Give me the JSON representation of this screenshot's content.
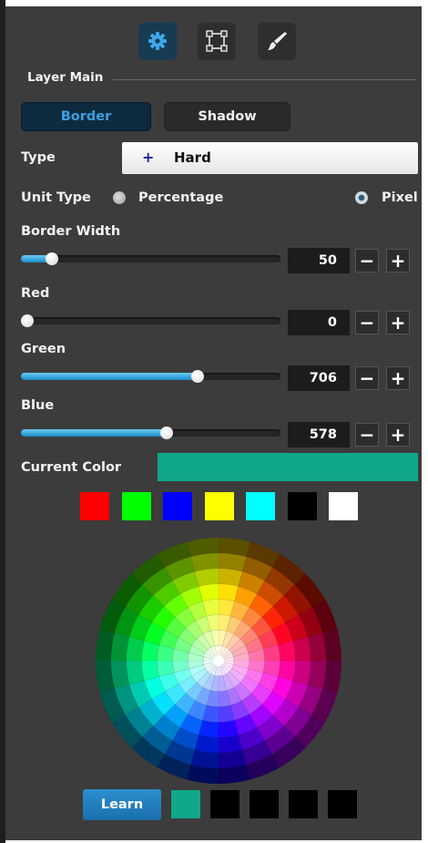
{
  "toolbar": {
    "icons": [
      "gear-icon",
      "transform-icon",
      "brush-icon"
    ],
    "active_index": 0
  },
  "section": {
    "title": "Layer Main"
  },
  "tabs": [
    {
      "label": "Border",
      "active": true
    },
    {
      "label": "Shadow",
      "active": false
    }
  ],
  "type_field": {
    "label": "Type",
    "value": "Hard",
    "expand_symbol": "+"
  },
  "unit_type": {
    "label": "Unit Type",
    "options": [
      {
        "label": "Percentage",
        "selected": false
      },
      {
        "label": "Pixel",
        "selected": true
      }
    ]
  },
  "sliders": [
    {
      "label": "Border Width",
      "value": "50",
      "fraction": 0.12
    },
    {
      "label": "Red",
      "value": "0",
      "fraction": 0.0
    },
    {
      "label": "Green",
      "value": "706",
      "fraction": 0.68
    },
    {
      "label": "Blue",
      "value": "578",
      "fraction": 0.56
    }
  ],
  "stepper": {
    "minus": "−",
    "plus": "+"
  },
  "current_color": {
    "label": "Current Color",
    "hex": "#0fa88a"
  },
  "presets": [
    "#ff0000",
    "#00ff00",
    "#0000ff",
    "#ffff00",
    "#00ffff",
    "#000000",
    "#ffffff"
  ],
  "learn_button": {
    "label": "Learn"
  },
  "history": [
    "#0fa88a",
    "#000000",
    "#000000",
    "#000000",
    "#000000"
  ]
}
